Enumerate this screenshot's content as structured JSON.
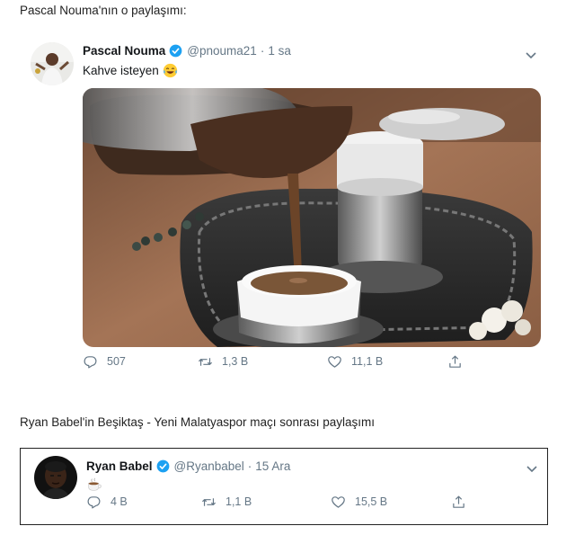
{
  "captions": {
    "first": "Pascal Nouma'nın o paylaşımı:",
    "second": "Ryan Babel'in Beşiktaş - Yeni Malatyaspor maçı sonrası paylaşımı"
  },
  "tweets": [
    {
      "name": "Pascal Nouma",
      "handle": "@pnouma21",
      "separator": "·",
      "time": "1 sa",
      "text": "Kahve isteyen",
      "text_emoji": "face-with-tears-of-joy-icon",
      "image": "turkish-coffee-photo",
      "replies": "507",
      "retweets": "1,3 B",
      "likes": "11,1 B"
    },
    {
      "name": "Ryan Babel",
      "handle": "@Ryanbabel",
      "separator": "·",
      "time": "15 Ara",
      "text_emoji": "hot-beverage-icon",
      "replies": "4 B",
      "retweets": "1,1 B",
      "likes": "15,5 B"
    }
  ],
  "colors": {
    "verified": "#1da1f2",
    "muted": "#657786"
  }
}
